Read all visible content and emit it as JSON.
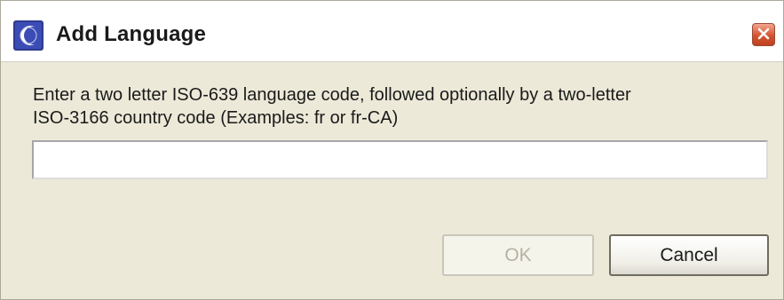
{
  "window": {
    "title": "Add Language",
    "app_icon": "eclipse-icon",
    "close_icon": "close-icon"
  },
  "prompt": {
    "line1": "Enter a two letter ISO-639 language code, followed optionally by a two-letter",
    "line2": "ISO-3166 country code (Examples: fr or fr-CA)"
  },
  "language_input": {
    "value": "",
    "placeholder": ""
  },
  "buttons": {
    "ok_label": "OK",
    "ok_enabled": false,
    "cancel_label": "Cancel"
  },
  "colors": {
    "dialog_background": "#ece9d8",
    "close_button": "#d2542f",
    "disabled_text": "#b5b2a4"
  }
}
